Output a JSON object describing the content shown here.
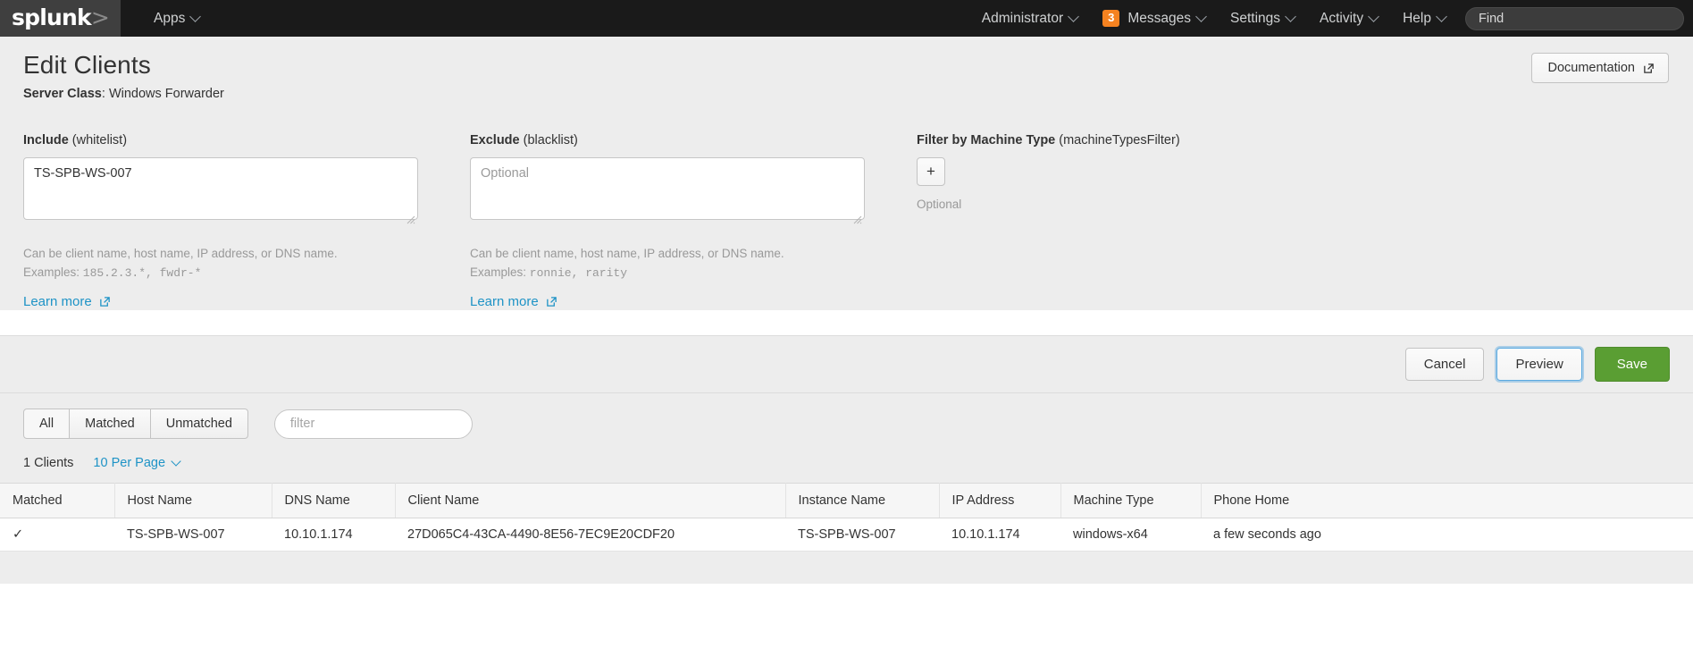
{
  "navbar": {
    "logo": "splunk",
    "logo_suffix": ">",
    "apps_label": "Apps",
    "right_items": [
      {
        "label": "Administrator",
        "caret": true,
        "badge": null
      },
      {
        "label": "Messages",
        "caret": true,
        "badge": "3"
      },
      {
        "label": "Settings",
        "caret": true,
        "badge": null
      },
      {
        "label": "Activity",
        "caret": true,
        "badge": null
      },
      {
        "label": "Help",
        "caret": true,
        "badge": null
      }
    ],
    "find_value": "Find",
    "find_placeholder": "Find"
  },
  "header": {
    "title": "Edit Clients",
    "subtitle_label": "Server Class",
    "subtitle_sep": ": ",
    "subtitle_value": "Windows Forwarder",
    "documentation_label": "Documentation",
    "documentation_icon": "external-link-icon"
  },
  "include": {
    "label_bold": "Include",
    "label_rest": " (whitelist)",
    "value": "TS-SPB-WS-007",
    "placeholder": "Optional",
    "hint_line1": "Can be client name, host name, IP address, or DNS name.",
    "hint_examples_label": "Examples: ",
    "hint_examples_value": "185.2.3.*,  fwdr-*",
    "learn_more": "Learn more"
  },
  "exclude": {
    "label_bold": "Exclude",
    "label_rest": " (blacklist)",
    "value": "",
    "placeholder": "Optional",
    "hint_line1": "Can be client name, host name, IP address, or DNS name.",
    "hint_examples_label": "Examples: ",
    "hint_examples_value": "ronnie,  rarity",
    "learn_more": "Learn more"
  },
  "machine_type": {
    "label_bold": "Filter by Machine Type",
    "label_rest": " (machineTypesFilter)",
    "add_button": "+",
    "optional_label": "Optional"
  },
  "actions": {
    "cancel": "Cancel",
    "preview": "Preview",
    "save": "Save"
  },
  "results": {
    "segments": [
      {
        "label": "All",
        "active": true
      },
      {
        "label": "Matched",
        "active": false
      },
      {
        "label": "Unmatched",
        "active": false
      }
    ],
    "filter_placeholder": "filter",
    "filter_value": "",
    "count_label": "1 Clients",
    "per_page_label": "10 Per Page",
    "columns": [
      "Matched",
      "Host Name",
      "DNS Name",
      "Client Name",
      "Instance Name",
      "IP Address",
      "Machine Type",
      "Phone Home"
    ],
    "rows": [
      {
        "matched": "✓",
        "host_name": "TS-SPB-WS-007",
        "dns_name": "10.10.1.174",
        "client_name": "27D065C4-43CA-4490-8E56-7EC9E20CDF20",
        "instance_name": "TS-SPB-WS-007",
        "ip_address": "10.10.1.174",
        "machine_type": "windows-x64",
        "phone_home": "a few seconds ago"
      }
    ]
  },
  "colors": {
    "navbar_bg": "#1a1a1a",
    "logo_cell_bg": "#3f3f3f",
    "badge_orange": "#f58220",
    "link_blue": "#1e93c6",
    "save_green": "#5a9e33",
    "page_bg": "#ededed"
  }
}
